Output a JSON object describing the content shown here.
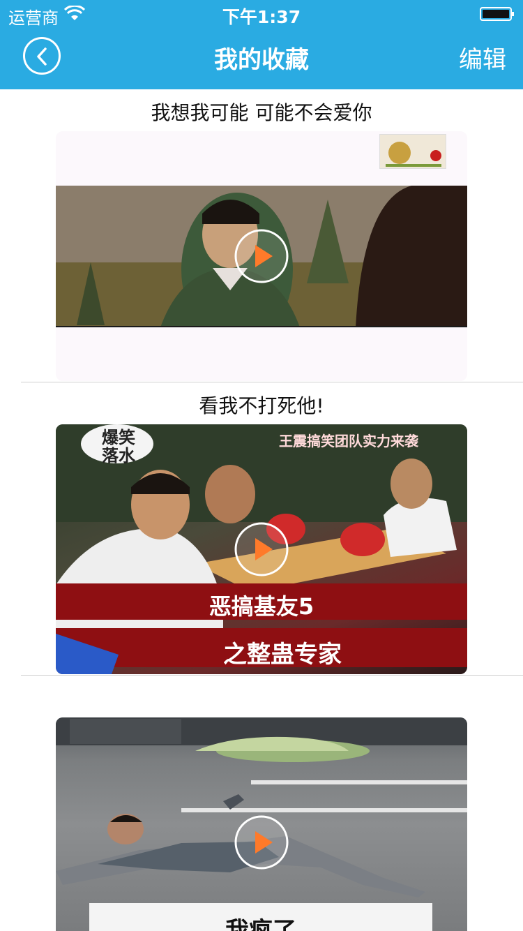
{
  "status_bar": {
    "carrier": "运营商",
    "time": "下午1:37"
  },
  "nav": {
    "title": "我的收藏",
    "edit_label": "编辑"
  },
  "items": [
    {
      "title": "我想我可能 可能不会爱你"
    },
    {
      "title": "看我不打死他!",
      "badge": "爆笑\n落水",
      "banner_top": "王震搞笑团队实力来袭",
      "banner_mid": "恶搞基友5",
      "banner_bottom": "之整蛊专家"
    },
    {
      "title": "",
      "caption": "我疯了"
    }
  ],
  "colors": {
    "header_bg": "#2aabe2",
    "play_accent": "#ff7a2a"
  },
  "icons": {
    "back": "back-icon",
    "play": "play-icon",
    "wifi": "wifi-icon",
    "battery": "battery-icon"
  }
}
